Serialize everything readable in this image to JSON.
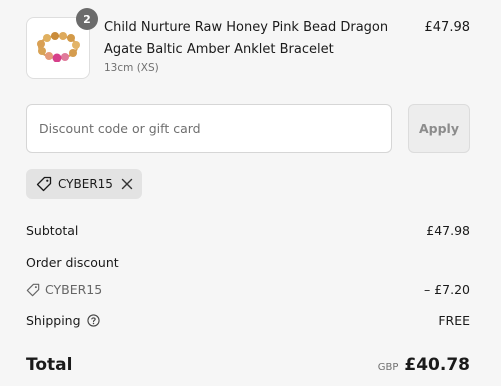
{
  "product": {
    "quantity": "2",
    "title": "Child Nurture Raw Honey Pink Bead Dragon Agate Baltic Amber Anklet Bracelet",
    "variant": "13cm (XS)",
    "price": "£47.98"
  },
  "discount": {
    "placeholder": "Discount code or gift card",
    "apply_label": "Apply",
    "applied_code": "CYBER15"
  },
  "summary": {
    "subtotal_label": "Subtotal",
    "subtotal_value": "£47.98",
    "order_discount_label": "Order discount",
    "discount_code": "CYBER15",
    "discount_value": "– £7.20",
    "shipping_label": "Shipping",
    "shipping_value": "FREE",
    "total_label": "Total",
    "currency": "GBP",
    "total_value": "£40.78"
  },
  "icons": {
    "tag": "tag-icon",
    "close": "close-icon",
    "help": "help-circle-icon"
  }
}
